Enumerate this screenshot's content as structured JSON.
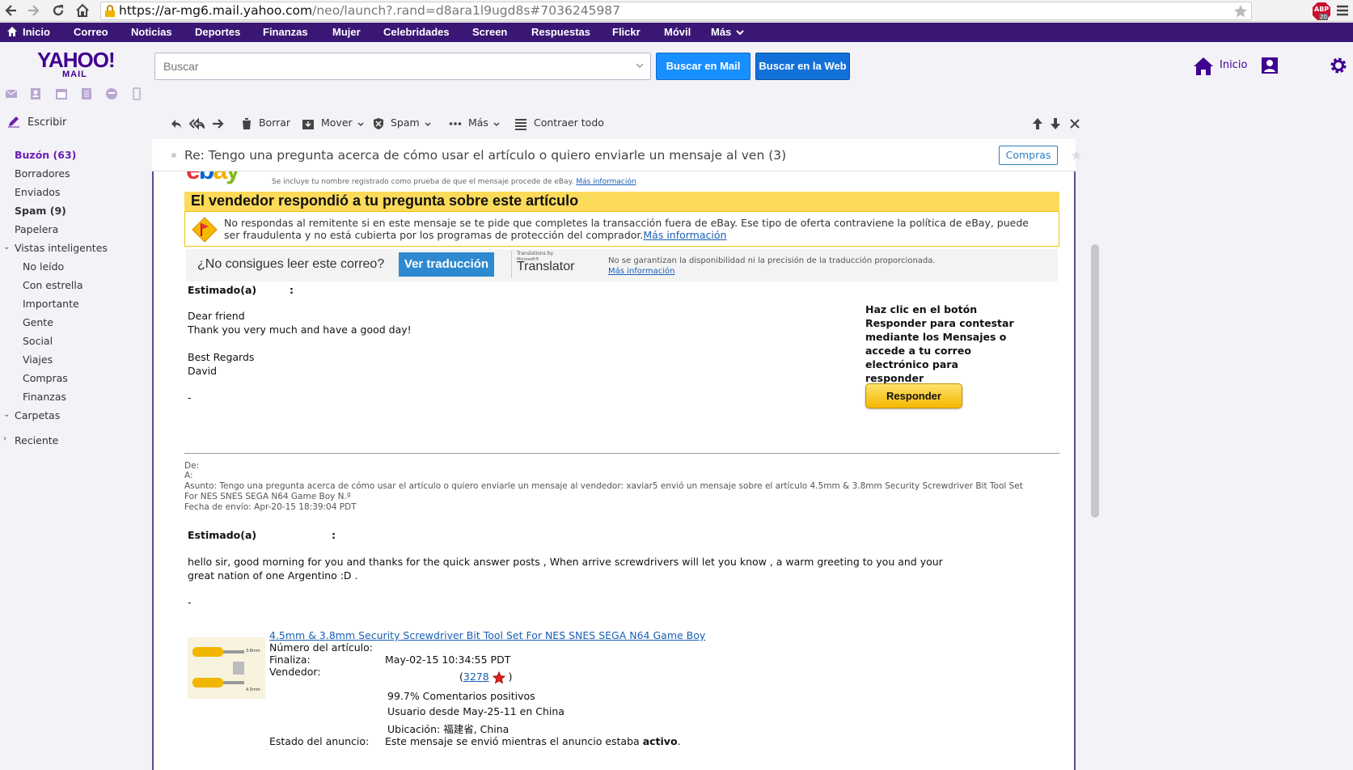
{
  "browser": {
    "url_host": "https://ar-mg6.mail.yahoo.com",
    "url_rest": "/neo/launch?.rand=d8ara1l9ugd8s#7036245987",
    "adblock_label": "ABP",
    "adblock_count": "20"
  },
  "yahoo_nav": {
    "items": [
      "Inicio",
      "Correo",
      "Noticias",
      "Deportes",
      "Finanzas",
      "Mujer",
      "Celebridades",
      "Screen",
      "Respuestas",
      "Flickr",
      "Móvil",
      "Más"
    ]
  },
  "header": {
    "logo_main": "YAHOO!",
    "logo_sub": "MAIL",
    "search_placeholder": "Buscar",
    "search_mail_label": "Buscar en Mail",
    "search_web_label": "Buscar en la Web",
    "home_label": "Inicio"
  },
  "sidebar": {
    "compose_label": "Escribir",
    "folders": [
      "Buzón (63)",
      "Borradores",
      "Enviados",
      "Spam (9)",
      "Papelera"
    ],
    "smart_views_label": "Vistas inteligentes",
    "smart_views": [
      "No leído",
      "Con estrella",
      "Importante",
      "Gente",
      "Social",
      "Viajes",
      "Compras",
      "Finanzas"
    ],
    "folders_label": "Carpetas",
    "recent_label": "Reciente"
  },
  "toolbar": {
    "delete_label": "Borrar",
    "move_label": "Mover",
    "spam_label": "Spam",
    "more_label": "Más",
    "collapse_label": "Contraer todo"
  },
  "message": {
    "subject": "Re: Tengo una pregunta acerca de cómo usar el artículo o quiero enviarle un mensaje al ven (3)",
    "tag": "Compras",
    "ebay_logo": "ebay",
    "registered_note": "Se incluye tu nombre registrado como prueba de que el mensaje procede de eBay.",
    "registered_link": "Más información",
    "headline": "El vendedor respondió a tu pregunta sobre este artículo",
    "warning_text": "No respondas al remitente si en este mensaje se te pide que completes la transacción fuera de eBay. Ese tipo de oferta contraviene la política de eBay, puede ser fraudulenta y no está cubierta por los programas de protección del comprador.",
    "warning_link": "Más información",
    "translate_question": "¿No consigues leer este correo?",
    "translate_button": "Ver traducción",
    "translator_by": "Translations by",
    "translator_ms": "Microsoft®",
    "translator_name": "Translator",
    "translate_note": "No se garantizan la disponibilidad ni la precisión de la traducción proporcionada.",
    "translate_link": "Más información",
    "greeting": "Estimado(a)",
    "greeting_colon": ":",
    "body_line1": "Dear friend",
    "body_line2": "Thank you very much and have a good day!",
    "body_line3": "Best Regards",
    "body_line4": "David",
    "body_dash": "-",
    "reply_prompt_1": "Haz clic en el botón",
    "reply_prompt_2": "Responder para contestar",
    "reply_prompt_3": "mediante los Mensajes o",
    "reply_prompt_4": "accede a tu correo",
    "reply_prompt_5": "electrónico para responder",
    "reply_button": "Responder",
    "hdr_from": "De:",
    "hdr_to": "A:",
    "hdr_subject_1": "Asunto: Tengo una pregunta acerca de cómo usar el artículo o quiero enviarle un mensaje al vendedor: xaviar5 envió un mensaje sobre el artículo 4.5mm & 3.8mm Security Screwdriver Bit Tool Set",
    "hdr_subject_2": "For NES SNES SEGA N64 Game Boy N.º",
    "hdr_date": "Fecha de envío: Apr-20-15 18:39:04 PDT",
    "greeting2": "Estimado(a)",
    "greeting2_colon": ":",
    "quoted_line1": "hello sir, good morning for you and thanks for the quick answer posts , When arrive screwdrivers will let you know , a warm greeting to you and your",
    "quoted_line2": "great nation of one Argentino :D .",
    "quoted_dash": "-",
    "product_title": "4.5mm & 3.8mm Security Screwdriver Bit Tool Set For NES SNES SEGA N64 Game Boy",
    "product_img_label_top": "3.8mm",
    "product_img_label_bottom": "4.5mm",
    "item_number_label": "Número del artículo:",
    "ends_label": "Finaliza:",
    "ends_value": "May-02-15 10:34:55 PDT",
    "seller_label": "Vendedor:",
    "seller_open": "(",
    "seller_feedback": "3278",
    "seller_close": ")",
    "seller_positive": "99.7% Comentarios positivos",
    "seller_since": "Usuario desde May-25-11 en China",
    "seller_location": "Ubicación: 福建省, China",
    "listing_status_label": "Estado del anuncio:",
    "listing_status_text": "Este mensaje se envió mientras el anuncio estaba",
    "listing_status_value": "activo",
    "listing_status_end": "."
  }
}
